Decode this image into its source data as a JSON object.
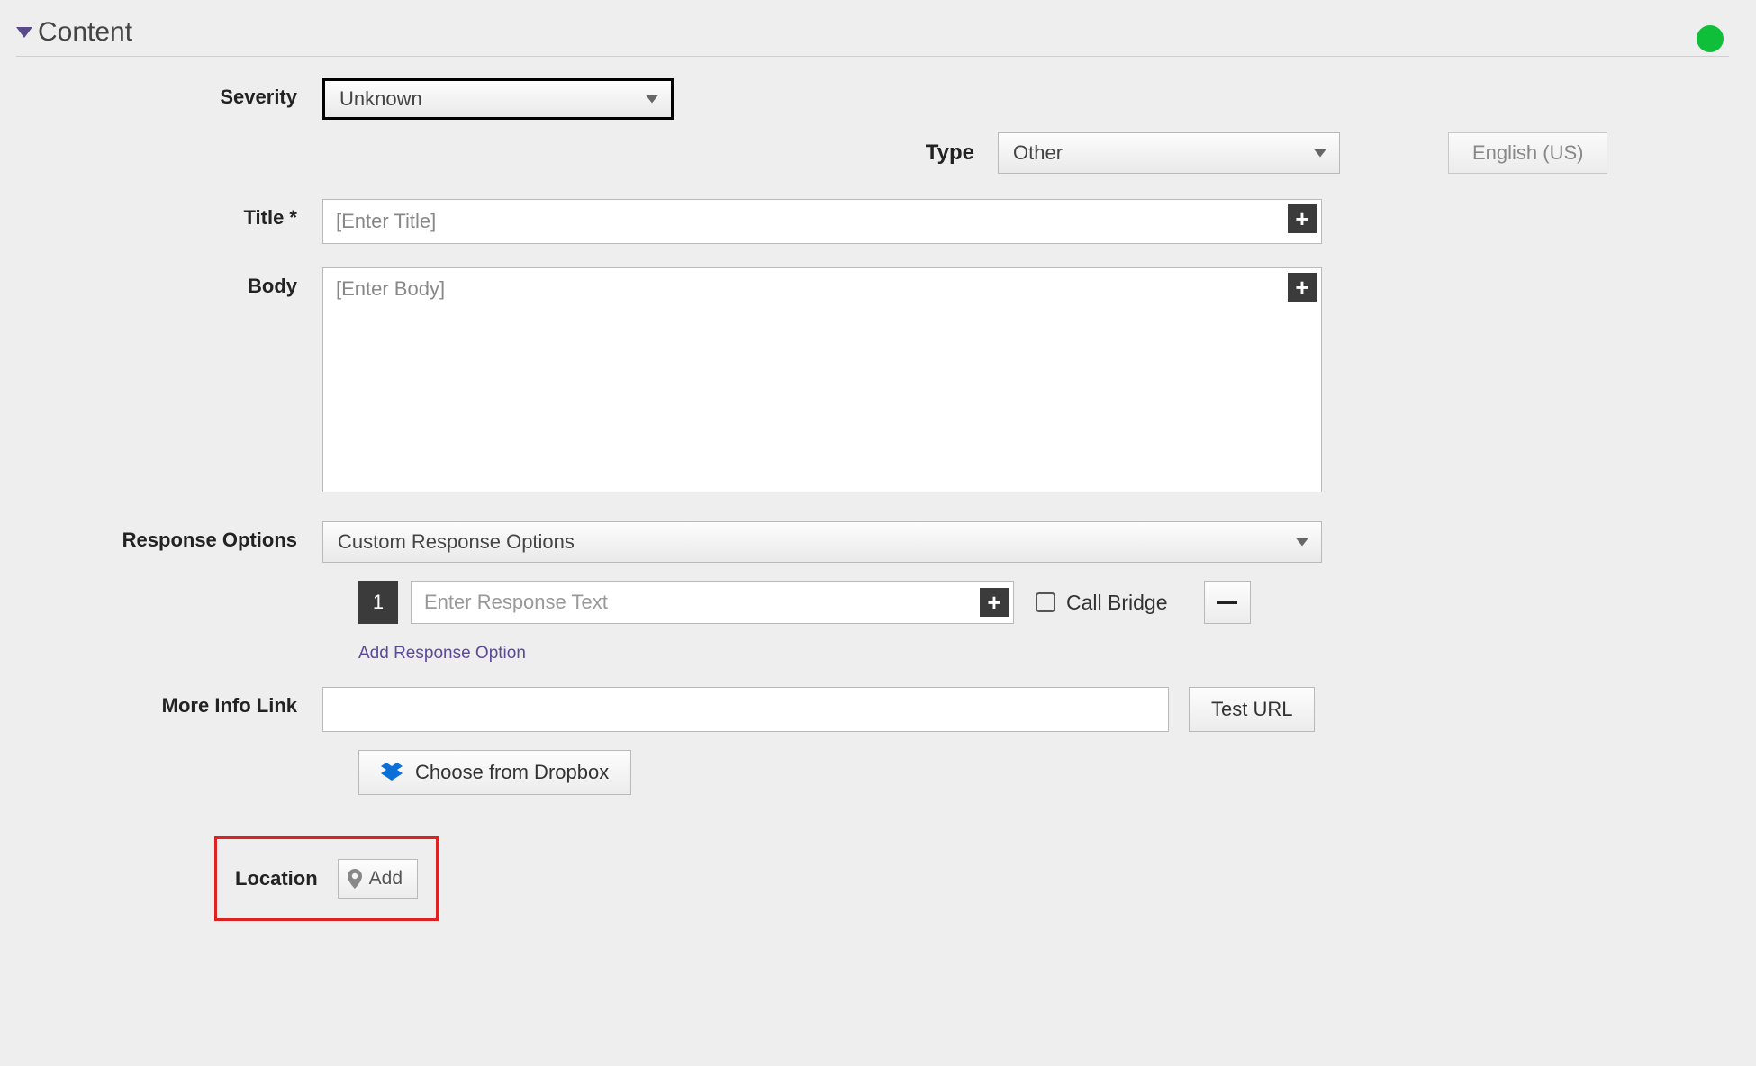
{
  "panel": {
    "title": "Content"
  },
  "severity": {
    "label": "Severity",
    "value": "Unknown"
  },
  "typeRow": {
    "label": "Type",
    "value": "Other",
    "lang": "English (US)"
  },
  "titleField": {
    "label": "Title *",
    "placeholder": "[Enter Title]"
  },
  "bodyField": {
    "label": "Body",
    "placeholder": "[Enter Body]"
  },
  "responseOptions": {
    "label": "Response Options",
    "value": "Custom Response Options",
    "items": [
      {
        "index": "1",
        "placeholder": "Enter Response Text",
        "callBridge": "Call Bridge"
      }
    ],
    "addLink": "Add Response Option"
  },
  "moreInfo": {
    "label": "More Info Link",
    "testBtn": "Test URL",
    "dropboxBtn": "Choose from Dropbox"
  },
  "location": {
    "label": "Location",
    "addBtn": "Add"
  }
}
